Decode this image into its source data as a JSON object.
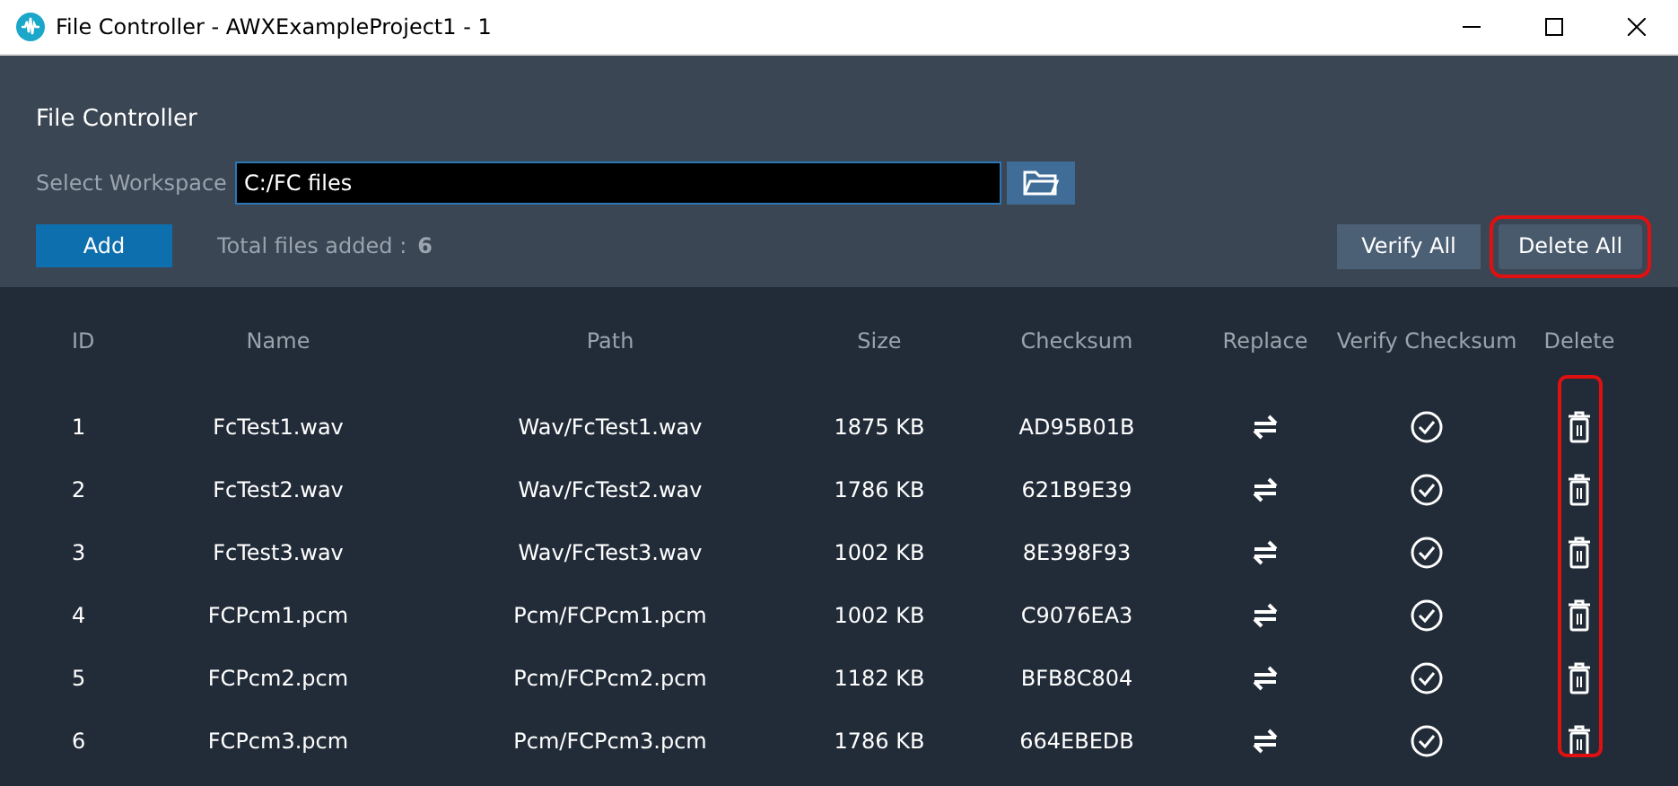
{
  "window": {
    "title": "File Controller - AWXExampleProject1 - 1"
  },
  "header": {
    "title": "File Controller",
    "workspace_label": "Select Workspace",
    "workspace_value": "C:/FC files",
    "add_button": "Add",
    "total_label": "Total files added :",
    "total_value": "6",
    "verify_all": {
      "label": "Verify All",
      "highlighted": false
    },
    "delete_all": {
      "label": "Delete All",
      "highlighted": true
    }
  },
  "table": {
    "columns": [
      "ID",
      "Name",
      "Path",
      "Size",
      "Checksum",
      "Replace",
      "Verify Checksum",
      "Delete"
    ],
    "delete_column_highlighted": true,
    "rows": [
      {
        "id": "1",
        "name": "FcTest1.wav",
        "path": "Wav/FcTest1.wav",
        "size": "1875 KB",
        "checksum": "AD95B01B"
      },
      {
        "id": "2",
        "name": "FcTest2.wav",
        "path": "Wav/FcTest2.wav",
        "size": "1786 KB",
        "checksum": "621B9E39"
      },
      {
        "id": "3",
        "name": "FcTest3.wav",
        "path": "Wav/FcTest3.wav",
        "size": "1002 KB",
        "checksum": "8E398F93"
      },
      {
        "id": "4",
        "name": "FCPcm1.pcm",
        "path": "Pcm/FCPcm1.pcm",
        "size": "1002 KB",
        "checksum": "C9076EA3"
      },
      {
        "id": "5",
        "name": "FCPcm2.pcm",
        "path": "Pcm/FCPcm2.pcm",
        "size": "1182 KB",
        "checksum": "BFB8C804"
      },
      {
        "id": "6",
        "name": "FCPcm3.pcm",
        "path": "Pcm/FCPcm3.pcm",
        "size": "1786 KB",
        "checksum": "664EBEDB"
      }
    ]
  }
}
